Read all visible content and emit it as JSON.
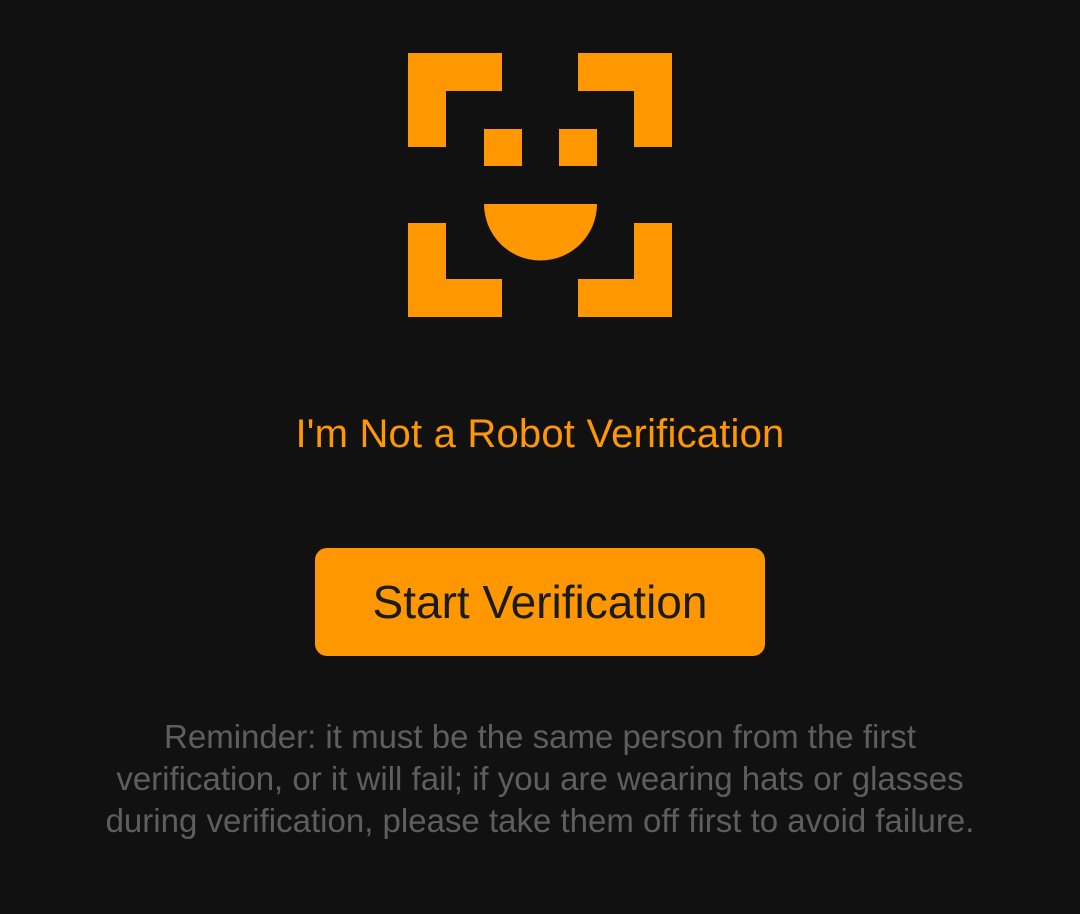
{
  "colors": {
    "background": "#111111",
    "accent": "#ff9800",
    "button_text": "#1b1b1b",
    "reminder_text": "#5e5e5e"
  },
  "icon": "face-scan-icon",
  "title": "I'm Not a Robot Verification",
  "start_button_label": "Start Verification",
  "reminder": "Reminder: it must be the same person from the first verification, or it will fail; if you are wearing hats or glasses during verification, please take them off first to avoid failure."
}
